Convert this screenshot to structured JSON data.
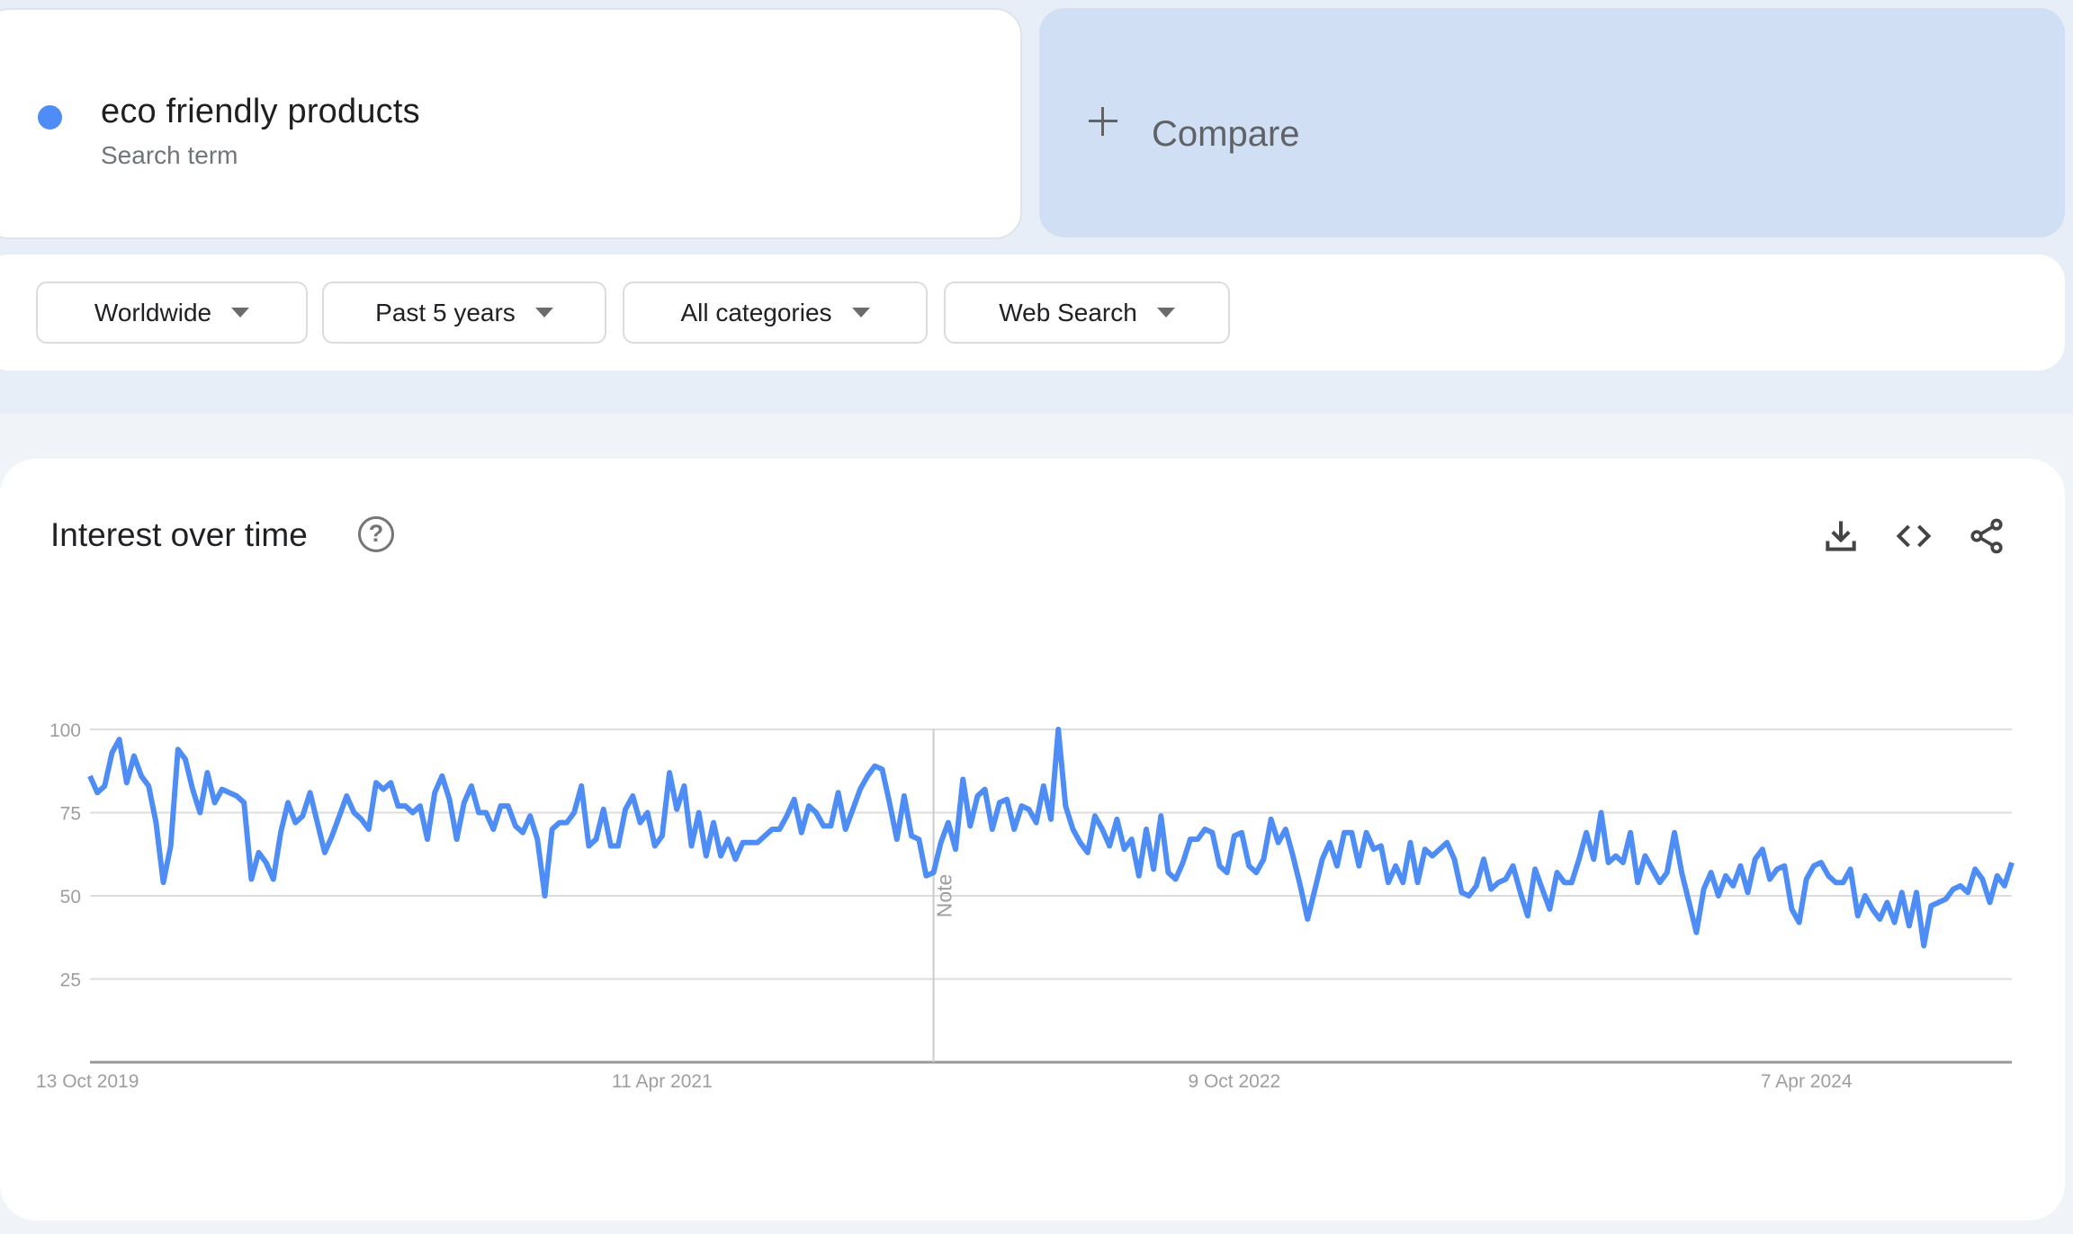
{
  "search_term": {
    "name": "eco friendly products",
    "type_label": "Search term",
    "color": "#4e8df5"
  },
  "compare": {
    "label": "Compare",
    "icon": "plus-icon"
  },
  "filters": [
    {
      "label": "Worldwide",
      "icon": "dropdown-arrow-icon"
    },
    {
      "label": "Past 5 years",
      "icon": "dropdown-arrow-icon"
    },
    {
      "label": "All categories",
      "icon": "dropdown-arrow-icon"
    },
    {
      "label": "Web Search",
      "icon": "dropdown-arrow-icon"
    }
  ],
  "interest_card": {
    "title": "Interest over time",
    "help_icon": "help-circle-icon",
    "actions": [
      {
        "name": "download",
        "icon": "download-icon"
      },
      {
        "name": "embed",
        "icon": "code-icon"
      },
      {
        "name": "share",
        "icon": "share-icon"
      }
    ]
  },
  "chart_data": {
    "type": "line",
    "title": "Interest over time",
    "xlabel": "",
    "ylabel": "",
    "ylim": [
      0,
      100
    ],
    "y_ticks": [
      "100",
      "75",
      "50",
      "25"
    ],
    "grid": true,
    "x_tick_labels": [
      "13 Oct 2019",
      "11 Apr 2021",
      "9 Oct 2022",
      "7 Apr 2024"
    ],
    "x_tick_indices": [
      0,
      78,
      156,
      234
    ],
    "note": {
      "label": "Note",
      "index": 115
    },
    "series": [
      {
        "name": "eco friendly products",
        "color": "#4e8df5",
        "values": [
          86,
          81,
          83,
          93,
          97,
          84,
          92,
          86,
          83,
          72,
          54,
          65,
          94,
          91,
          82,
          75,
          87,
          78,
          82,
          81,
          80,
          78,
          55,
          63,
          60,
          55,
          69,
          78,
          72,
          74,
          81,
          72,
          63,
          68,
          74,
          80,
          75,
          73,
          70,
          84,
          82,
          84,
          77,
          77,
          75,
          77,
          67,
          81,
          86,
          79,
          67,
          78,
          83,
          75,
          75,
          70,
          77,
          77,
          71,
          69,
          74,
          67,
          50,
          70,
          72,
          72,
          75,
          83,
          65,
          67,
          76,
          65,
          65,
          76,
          80,
          72,
          75,
          65,
          68,
          87,
          76,
          83,
          65,
          75,
          62,
          72,
          62,
          67,
          61,
          66,
          66,
          66,
          68,
          70,
          70,
          74,
          79,
          69,
          77,
          75,
          71,
          71,
          81,
          70,
          76,
          82,
          86,
          89,
          88,
          78,
          67,
          80,
          68,
          67,
          56,
          57,
          66,
          72,
          64,
          85,
          71,
          80,
          82,
          70,
          78,
          79,
          70,
          77,
          76,
          72,
          83,
          73,
          100,
          77,
          70,
          66,
          63,
          74,
          70,
          65,
          73,
          64,
          67,
          56,
          70,
          58,
          74,
          57,
          55,
          60,
          67,
          67,
          70,
          69,
          59,
          57,
          68,
          69,
          59,
          57,
          61,
          73,
          66,
          70,
          62,
          53,
          43,
          52,
          61,
          66,
          59,
          69,
          69,
          59,
          69,
          64,
          65,
          54,
          59,
          54,
          66,
          54,
          64,
          62,
          64,
          66,
          61,
          51,
          50,
          53,
          61,
          52,
          54,
          55,
          59,
          51,
          44,
          58,
          52,
          46,
          57,
          54,
          54,
          61,
          69,
          61,
          75,
          60,
          62,
          60,
          69,
          54,
          62,
          58,
          54,
          57,
          69,
          57,
          48,
          39,
          52,
          57,
          50,
          56,
          53,
          59,
          51,
          61,
          64,
          55,
          58,
          59,
          46,
          42,
          55,
          59,
          60,
          56,
          54,
          54,
          58,
          44,
          50,
          46,
          43,
          48,
          42,
          51,
          41,
          51,
          35,
          47,
          48,
          49,
          52,
          53,
          51,
          58,
          55,
          48,
          56,
          53,
          60
        ]
      }
    ]
  }
}
